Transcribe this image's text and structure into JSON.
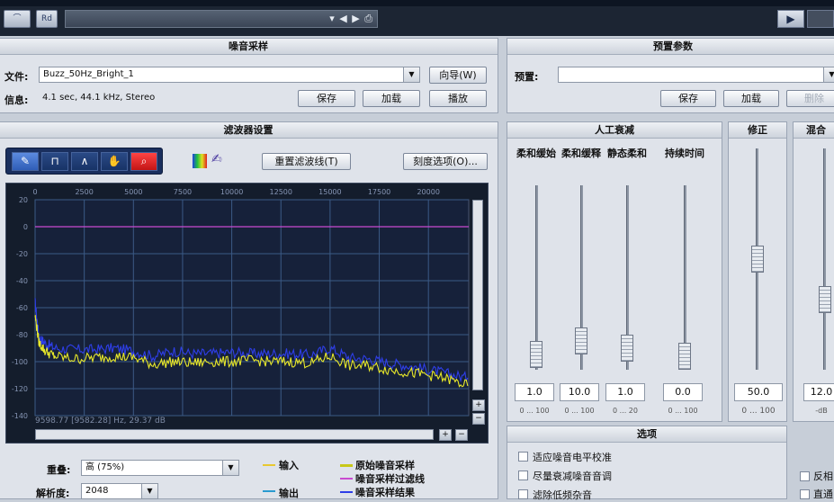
{
  "topbar": {
    "btn_wave": "⌒",
    "btn_rd": "Rd",
    "track_controls": "▾ ◀ ▶ ⎙",
    "play_icon": "▶"
  },
  "noise_sample": {
    "title": "噪音采样",
    "file_label": "文件:",
    "file_value": "Buzz_50Hz_Bright_1",
    "wizard_button": "向导(W)",
    "info_label": "信息:",
    "info_value": "4.1 sec, 44.1 kHz, Stereo",
    "save": "保存",
    "load": "加载",
    "play": "播放"
  },
  "preset": {
    "title": "预置参数",
    "preset_label": "预置:",
    "preset_value": "",
    "save": "保存",
    "load": "加载",
    "delete": "删除"
  },
  "filter": {
    "title": "滤波器设置",
    "reset_button": "重置滤波线(T)",
    "scale_button": "刻度选项(O)...",
    "status": "9598.77 [9582.28] Hz, 29.37 dB",
    "tools": [
      "pencil-icon",
      "pulse-icon",
      "peak-icon",
      "hand-icon",
      "zoom-icon"
    ]
  },
  "chart_data": {
    "type": "line",
    "x_ticks": [
      "0",
      "2500",
      "5000",
      "7500",
      "10000",
      "12500",
      "15000",
      "17500",
      "20000"
    ],
    "y_ticks": [
      "20",
      "0",
      "-20",
      "-40",
      "-60",
      "-80",
      "-100",
      "-120",
      "-140"
    ],
    "xlim": [
      0,
      22050
    ],
    "ylim": [
      -140,
      20
    ],
    "series": [
      {
        "name": "原始噪音采样",
        "color": "#e8e82a",
        "x": [
          0,
          200,
          500,
          1000,
          2000,
          3000,
          4000,
          5000,
          6000,
          7000,
          8000,
          9000,
          10000,
          11000,
          12000,
          13000,
          14000,
          15000,
          16000,
          17000,
          18000,
          19000,
          20000,
          21000,
          22000
        ],
        "y": [
          -66,
          -86,
          -92,
          -96,
          -98,
          -97,
          -96,
          -97,
          -102,
          -100,
          -101,
          -100,
          -100,
          -99,
          -100,
          -100,
          -101,
          -96,
          -103,
          -103,
          -106,
          -108,
          -110,
          -113,
          -118
        ]
      },
      {
        "name": "噪音采样过滤线",
        "color": "#c94bd0",
        "x": [
          0,
          22050
        ],
        "y": [
          0,
          0
        ]
      },
      {
        "name": "噪音采样结果",
        "color": "#2e3ee8",
        "x": [
          0,
          200,
          500,
          1000,
          2000,
          3000,
          4000,
          5000,
          6000,
          7000,
          8000,
          9000,
          10000,
          11000,
          12000,
          13000,
          14000,
          15000,
          16000,
          17000,
          18000,
          19000,
          20000,
          21000,
          22000
        ],
        "y": [
          -56,
          -82,
          -86,
          -90,
          -91,
          -91,
          -90,
          -92,
          -96,
          -92,
          -94,
          -94,
          -93,
          -94,
          -94,
          -94,
          -95,
          -90,
          -97,
          -98,
          -101,
          -103,
          -106,
          -109,
          -112
        ]
      }
    ]
  },
  "bottom_left": {
    "overlap_label": "重叠:",
    "overlap_value": "高 (75%)",
    "resolution_label": "解析度:",
    "resolution_value": "2048",
    "legend_input": "输入",
    "legend_output": "输出",
    "legend_original": "原始噪音采样",
    "legend_filter": "噪音采样过滤线",
    "legend_result": "噪音采样结果"
  },
  "manual": {
    "title": "人工衰减",
    "sliders": [
      {
        "label": "柔和缓始",
        "value": "1.0",
        "range": "0 ... 100",
        "level": 0.01
      },
      {
        "label": "柔和缓释",
        "value": "10.0",
        "range": "0 ... 100",
        "level": 0.1
      },
      {
        "label": "静态柔和",
        "value": "1.0",
        "range": "0 ... 20",
        "level": 0.05
      },
      {
        "label": "持续时间",
        "value": "0.0",
        "range": "0 ... 100",
        "level": 0.0
      }
    ]
  },
  "correction": {
    "title": "修正",
    "value": "50.0",
    "range": "0 ... 100",
    "level": 0.5
  },
  "mix": {
    "title": "混合",
    "value": "12.0",
    "range": "-dB",
    "invert": "反相",
    "second": "直通"
  },
  "options": {
    "title": "选项",
    "items": [
      "适应噪音电平校准",
      "尽量衰减噪音音调",
      "滤除低频杂音"
    ]
  }
}
